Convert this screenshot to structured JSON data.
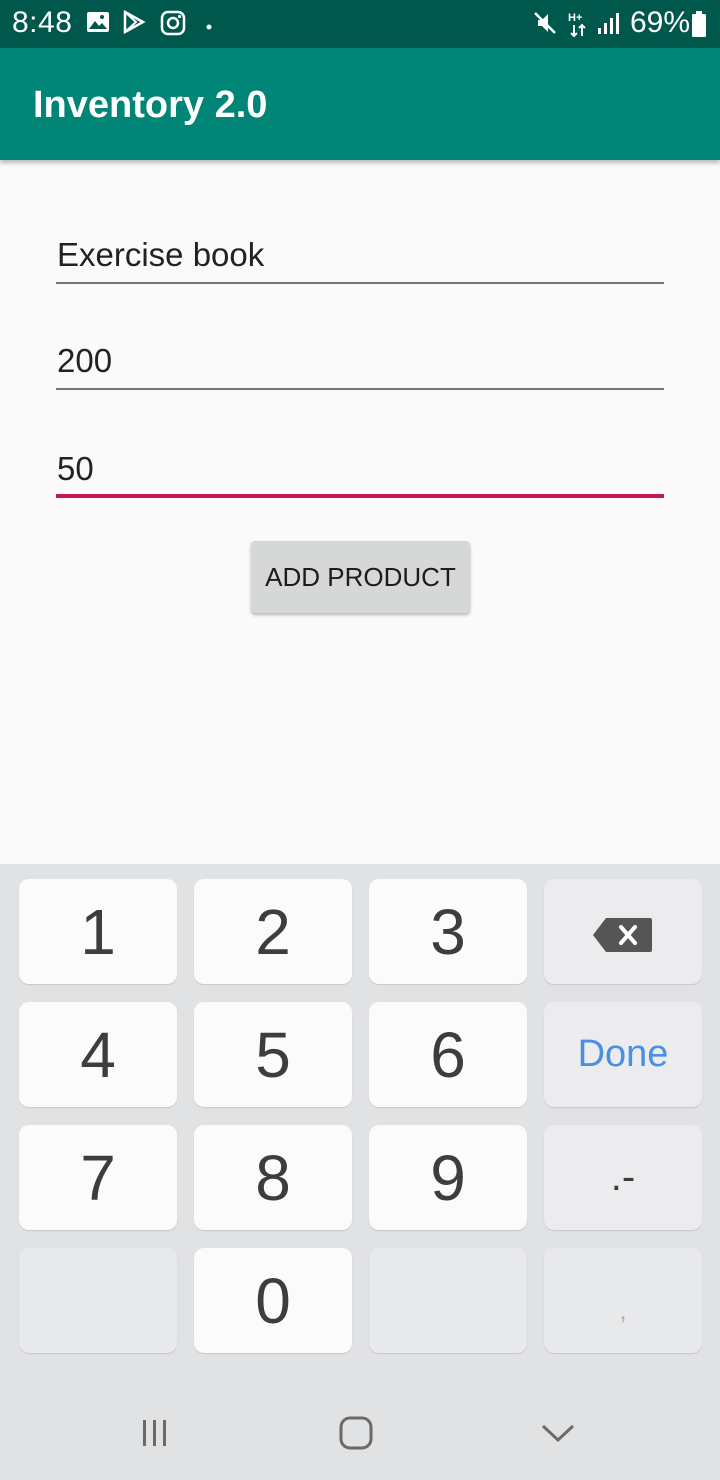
{
  "status_bar": {
    "time": "8:48",
    "battery": "69%",
    "icons": [
      "gallery-icon",
      "play-store-icon",
      "instagram-icon",
      "dot-icon",
      "mute-icon",
      "h-plus-data-icon",
      "signal-icon",
      "battery-icon"
    ]
  },
  "app_bar": {
    "title": "Inventory 2.0"
  },
  "form": {
    "name_value": "Exercise book",
    "price_value": "200",
    "quantity_value": "50",
    "focused_field": "quantity",
    "add_button_label": "ADD PRODUCT"
  },
  "keyboard": {
    "rows": [
      [
        "1",
        "2",
        "3",
        "backspace"
      ],
      [
        "4",
        "5",
        "6",
        "Done"
      ],
      [
        "7",
        "8",
        "9",
        ".-"
      ],
      [
        "",
        "0",
        "",
        ","
      ]
    ],
    "done_label": "Done",
    "colors": {
      "accent": "#4a90e2",
      "key": "#fbfbfc",
      "background": "#e1e2e4"
    }
  },
  "navigation": {
    "buttons": [
      "recent-apps-icon",
      "home-icon",
      "back-icon"
    ]
  },
  "colors": {
    "primary": "#008577",
    "primary_dark": "#00574b",
    "accent": "#c2185b"
  }
}
